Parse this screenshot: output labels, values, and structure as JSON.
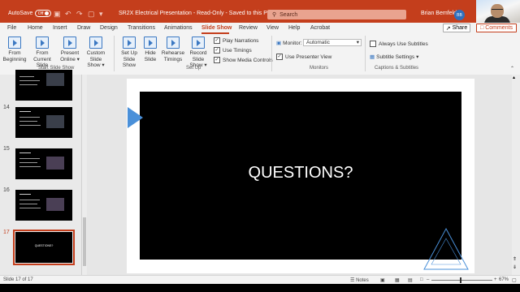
{
  "titlebar": {
    "autosave_label": "AutoSave",
    "autosave_state": "Off",
    "doc_title": "SR2X Electrical Presentation  -  Read-Only  -  Saved to this PC",
    "search_placeholder": "Search",
    "user_name": "Brian Bemfeld",
    "user_initials": "BB"
  },
  "menu": {
    "items": [
      "File",
      "Home",
      "Insert",
      "Draw",
      "Design",
      "Transitions",
      "Animations",
      "Slide Show",
      "Review",
      "View",
      "Help",
      "Acrobat"
    ],
    "active": "Slide Show",
    "share_label": "Share",
    "comments_label": "Comments"
  },
  "ribbon": {
    "start": {
      "from_beginning": [
        "From",
        "Beginning"
      ],
      "from_current": [
        "From",
        "Current Slide"
      ],
      "present_online": [
        "Present",
        "Online"
      ],
      "custom_show": [
        "Custom Slide",
        "Show"
      ],
      "group_label": "Start Slide Show"
    },
    "setup": {
      "set_up": [
        "Set Up",
        "Slide Show"
      ],
      "hide_slide": [
        "Hide",
        "Slide"
      ],
      "rehearse": [
        "Rehearse",
        "Timings"
      ],
      "record": [
        "Record Slide",
        "Show"
      ],
      "play_narrations": "Play Narrations",
      "use_timings": "Use Timings",
      "show_media_controls": "Show Media Controls",
      "group_label": "Set Up"
    },
    "monitors": {
      "monitor_label": "Monitor:",
      "monitor_value": "Automatic",
      "presenter_view": "Use Presenter View",
      "group_label": "Monitors"
    },
    "captions": {
      "always_use_subtitles": "Always Use Subtitles",
      "subtitle_settings": "Subtitle Settings",
      "group_label": "Captions & Subtitles"
    }
  },
  "thumbnails": [
    {
      "number": "14",
      "title": ""
    },
    {
      "number": "15",
      "title": ""
    },
    {
      "number": "16",
      "title": ""
    },
    {
      "number": "17",
      "title": "QUESTIONS?"
    }
  ],
  "slide": {
    "title": "QUESTIONS?"
  },
  "status": {
    "slide_counter": "Slide 17 of 17",
    "notes_label": "Notes",
    "zoom": "67%"
  },
  "colors": {
    "accent": "#c43e1c",
    "slide_bg": "#000000",
    "triangle_blue": "#4a90d9"
  }
}
